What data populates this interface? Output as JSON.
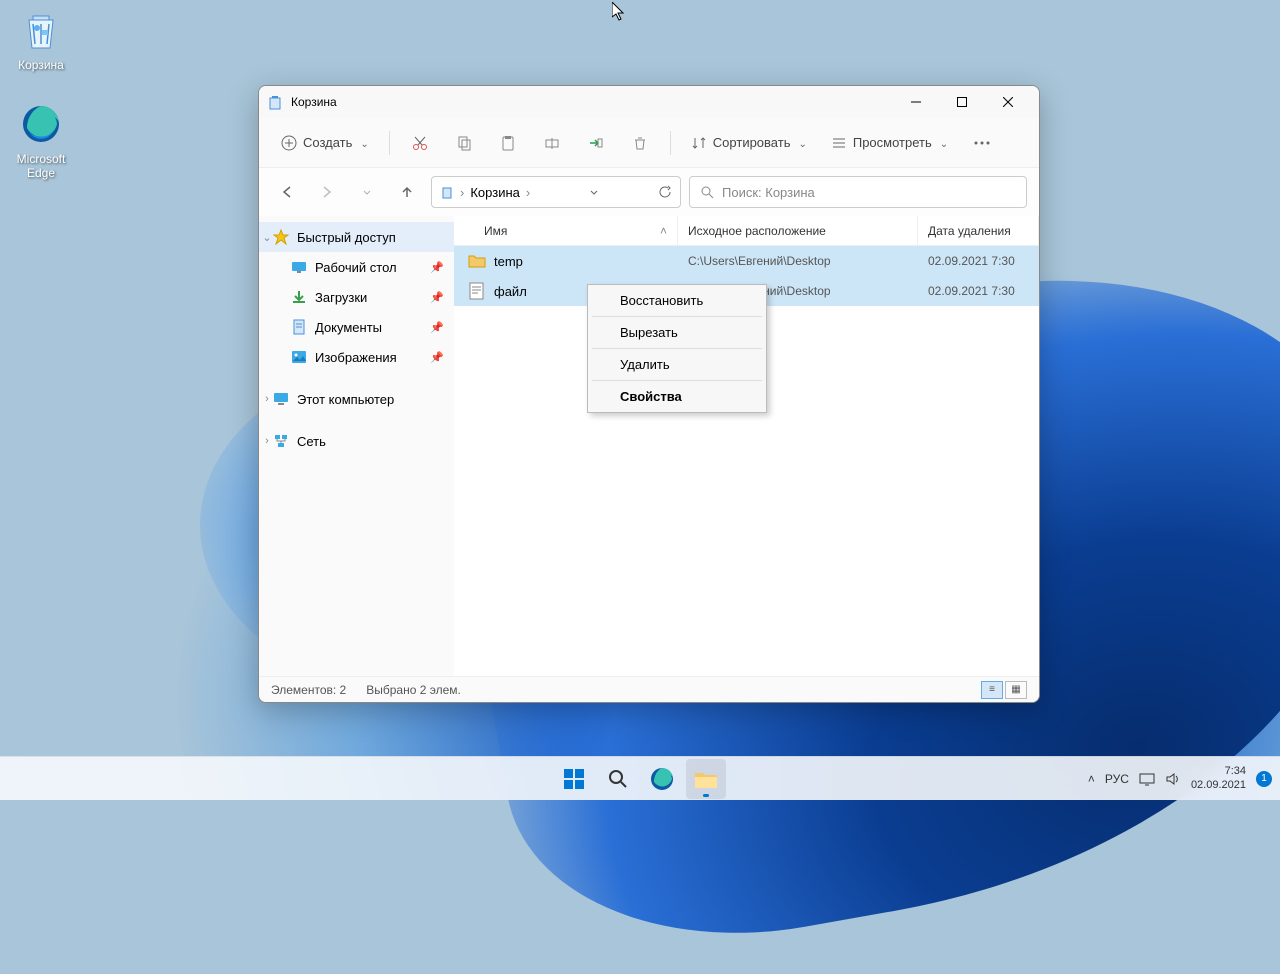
{
  "desktop": {
    "icons": [
      {
        "name": "recycle-bin",
        "label": "Корзина"
      },
      {
        "name": "edge",
        "label": "Microsoft Edge"
      }
    ]
  },
  "window": {
    "title": "Корзина",
    "toolbar": {
      "new": "Создать",
      "sort": "Сортировать",
      "view": "Просмотреть"
    },
    "breadcrumb": "Корзина",
    "search_placeholder": "Поиск: Корзина",
    "sidebar": {
      "quick_access": "Быстрый доступ",
      "desktop": "Рабочий стол",
      "downloads": "Загрузки",
      "documents": "Документы",
      "pictures": "Изображения",
      "this_pc": "Этот компьютер",
      "network": "Сеть"
    },
    "columns": {
      "name": "Имя",
      "location": "Исходное расположение",
      "date": "Дата удаления"
    },
    "rows": [
      {
        "name": "temp",
        "type": "folder",
        "location": "C:\\Users\\Евгений\\Desktop",
        "date": "02.09.2021 7:30"
      },
      {
        "name": "файл",
        "type": "text",
        "location": "C:\\Users\\Евгений\\Desktop",
        "date": "02.09.2021 7:30"
      }
    ],
    "context_menu": {
      "restore": "Восстановить",
      "cut": "Вырезать",
      "delete": "Удалить",
      "properties": "Свойства"
    },
    "status": {
      "items": "Элементов: 2",
      "selected": "Выбрано 2 элем."
    }
  },
  "taskbar": {
    "lang": "РУС",
    "time": "7:34",
    "date": "02.09.2021",
    "notif_count": "1"
  }
}
